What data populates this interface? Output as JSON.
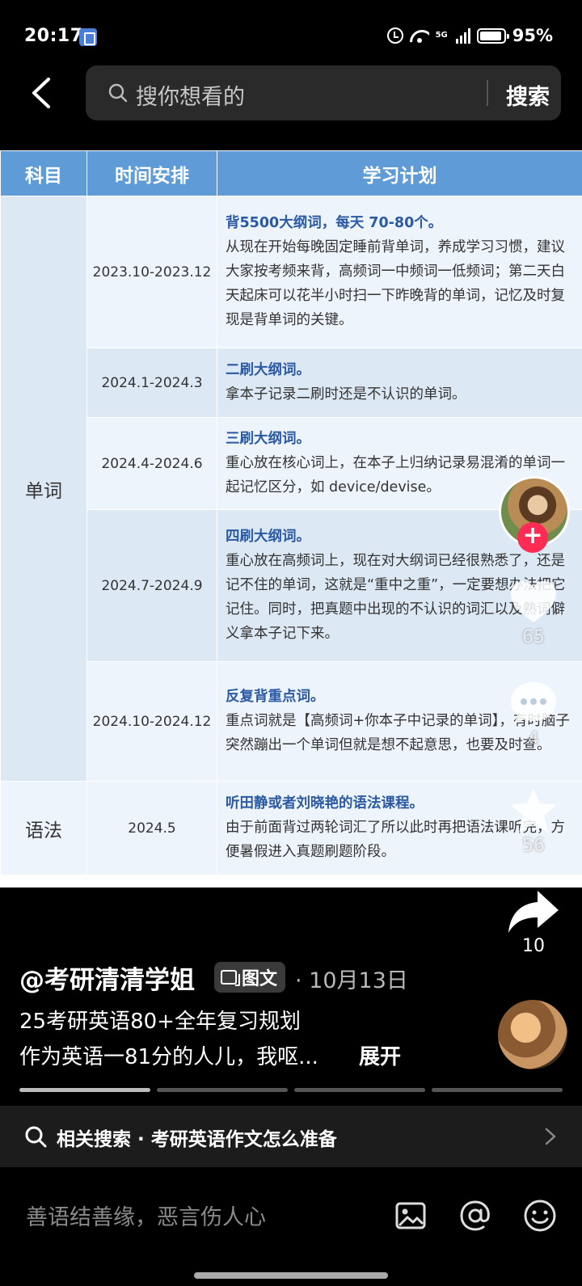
{
  "status_bar": {
    "time": "20:17",
    "network": "5G",
    "battery": "95%",
    "battery_level": 0.95,
    "icons": [
      "alarm-icon",
      "wifi-icon",
      "signal-icon",
      "battery-icon"
    ]
  },
  "header": {
    "search_placeholder": "搜你想看的",
    "search_button": "搜索"
  },
  "table": {
    "headers": [
      "科目",
      "时间安排",
      "学习计划"
    ],
    "groups": [
      {
        "subject": "单词",
        "rows": [
          {
            "time": "2023.10-2023.12",
            "head": "背5500大纲词，每天 70-80个。",
            "body": "从现在开始每晚固定睡前背单词，养成学习习惯，建议大家按考频来背，高频词一中频词一低频词；第二天白天起床可以花半小时扫一下昨晚背的单词，记忆及时复现是背单词的关键。"
          },
          {
            "time": "2024.1-2024.3",
            "head": "二刷大纲词。",
            "body": "拿本子记录二刷时还是不认识的单词。"
          },
          {
            "time": "2024.4-2024.6",
            "head": "三刷大纲词。",
            "body": "重心放在核心词上，在本子上归纳记录易混淆的单词一起记忆区分，如 device/devise。"
          },
          {
            "time": "2024.7-2024.9",
            "head": "四刷大纲词。",
            "body": "重心放在高频词上，现在对大纲词已经很熟悉了，还是记不住的单词，这就是“重中之重”，一定要想办法把它记住。同时，把真题中出现的不认识的词汇以及熟词僻义拿本子记下来。"
          },
          {
            "time": "2024.10-2024.12",
            "head": "反复背重点词。",
            "body": "重点词就是【高频词+你本子中记录的单词】，有时脑子突然蹦出一个单词但就是想不起意思，也要及时查。"
          }
        ]
      },
      {
        "subject": "语法",
        "rows": [
          {
            "time": "2024.5",
            "head": "听田静或者刘晓艳的语法课程。",
            "body": "由于前面背过两轮词汇了所以此时再把语法课听完，方便暑假进入真题刷题阶段。"
          }
        ]
      }
    ]
  },
  "actions": {
    "likes": "65",
    "comments": "4",
    "favorites": "56",
    "shares": "10"
  },
  "post": {
    "author": "@考研清清学姐",
    "type_tag": "图文",
    "date": "· 10月13日",
    "title": "25考研英语80+全年复习规划",
    "desc": "作为英语一81分的人儿，我呕...",
    "expand": "展开",
    "image_count": 4,
    "current_image": 1
  },
  "related": {
    "text": "相关搜索 · 考研英语作文怎么准备"
  },
  "comment_bar": {
    "placeholder": "善语结善缘，恶言伤人心"
  },
  "colors": {
    "table_header": "#5f9bd6",
    "plan_head": "#2b5aa3",
    "follow": "#fe2c55"
  }
}
